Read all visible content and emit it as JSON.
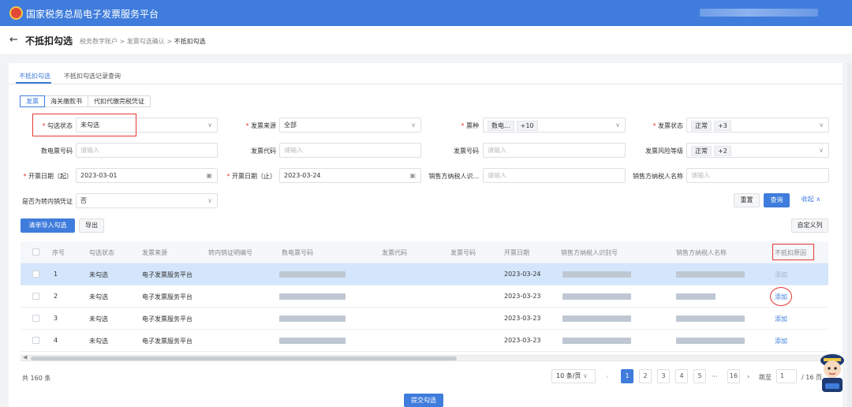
{
  "topbar": {
    "title": "国家税务总局电子发票服务平台"
  },
  "subhead": {
    "back": "←",
    "title": "不抵扣勾选",
    "breadcrumb": [
      "税务数字账户",
      "发票勾选确认",
      "不抵扣勾选"
    ],
    "sep": ">"
  },
  "tabs": [
    "不抵扣勾选",
    "不抵扣勾选记录查询"
  ],
  "subtabs": [
    "发票",
    "海关缴款书",
    "代扣代缴完税凭证"
  ],
  "filters": {
    "check_status": {
      "label": "勾选状态",
      "value": "未勾选"
    },
    "source": {
      "label": "发票来源",
      "value": "全部"
    },
    "ticket_type": {
      "label": "票种",
      "tag": "数电...",
      "more": "+10"
    },
    "invoice_status": {
      "label": "发票状态",
      "tag": "正常",
      "more": "+3"
    },
    "digital_no": {
      "label": "数电票号码",
      "placeholder": "请输入"
    },
    "invoice_code": {
      "label": "发票代码",
      "placeholder": "请输入"
    },
    "invoice_no": {
      "label": "发票号码",
      "placeholder": "请输入"
    },
    "risk_level": {
      "label": "发票风险等级",
      "tag": "正常",
      "more": "+2"
    },
    "date_start": {
      "label": "开票日期（起）",
      "value": "2023-03-01"
    },
    "date_end": {
      "label": "开票日期（止）",
      "value": "2023-03-24"
    },
    "seller_id": {
      "label": "销售方纳税人识...",
      "placeholder": "请输入"
    },
    "seller_name": {
      "label": "销售方纳税人名称",
      "placeholder": "请输入"
    },
    "transfer": {
      "label": "是否为转内销凭证",
      "value": "否"
    }
  },
  "actions": {
    "reset": "重置",
    "query": "查询",
    "collapse": "收起 ∧",
    "import": "清单导入勾选",
    "export": "导出",
    "custom_cols": "自定义列",
    "submit": "提交勾选"
  },
  "table": {
    "columns": [
      "序号",
      "勾选状态",
      "发票来源",
      "转内销证明编号",
      "数电票号码",
      "发票代码",
      "发票号码",
      "开票日期",
      "销售方纳税人识别号",
      "销售方纳税人名称",
      "不抵扣原因"
    ],
    "rows": [
      {
        "no": "1",
        "status": "未勾选",
        "source": "电子发票服务平台",
        "date": "2023-03-24",
        "action": "添加"
      },
      {
        "no": "2",
        "status": "未勾选",
        "source": "电子发票服务平台",
        "date": "2023-03-23",
        "action": "添加"
      },
      {
        "no": "3",
        "status": "未勾选",
        "source": "电子发票服务平台",
        "date": "2023-03-23",
        "action": "添加"
      },
      {
        "no": "4",
        "status": "未勾选",
        "source": "电子发票服务平台",
        "date": "2023-03-23",
        "action": "添加"
      }
    ]
  },
  "pagination": {
    "total": "共 160 条",
    "page_size": "10 条/页",
    "pages": [
      "1",
      "2",
      "3",
      "4",
      "5",
      "···",
      "16"
    ],
    "goto_label": "跳至",
    "goto_value": "1",
    "of_total": "/ 16 页"
  },
  "colors": {
    "primary": "#3f7cdc",
    "highlight": "#e53935"
  }
}
